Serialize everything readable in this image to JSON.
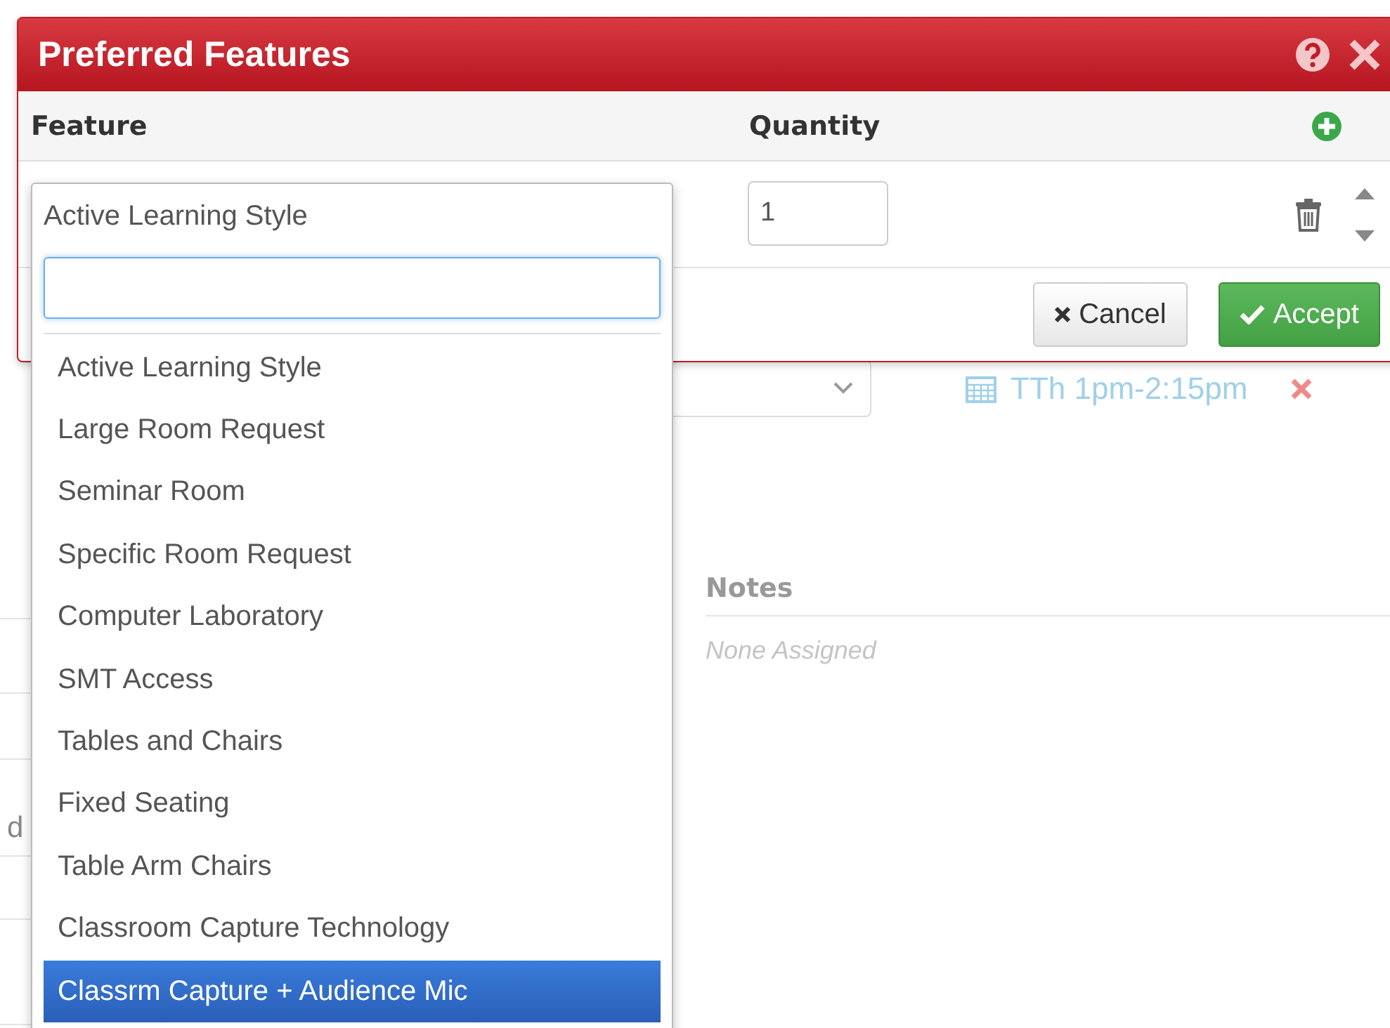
{
  "background": {
    "schedule": "TTh 1pm-2:15pm",
    "notes_heading": "Notes",
    "notes_value": "None Assigned",
    "side_text": "d"
  },
  "dialog": {
    "title": "Preferred Features",
    "columns": [
      "Feature",
      "Quantity"
    ],
    "rows": [
      {
        "feature": "Active Learning Style",
        "quantity": "1"
      }
    ],
    "buttons": [
      {
        "label": "Cancel",
        "kind": "cancel"
      },
      {
        "label": "Accept",
        "kind": "accept"
      }
    ]
  },
  "dropdown": {
    "options": [
      {
        "label": "Active Learning Style",
        "selected": false
      },
      {
        "label": "Large Room Request",
        "selected": false
      },
      {
        "label": "Seminar Room",
        "selected": false
      },
      {
        "label": "Specific Room Request",
        "selected": false
      },
      {
        "label": "Computer Laboratory",
        "selected": false
      },
      {
        "label": "SMT Access",
        "selected": false
      },
      {
        "label": "Tables and Chairs",
        "selected": false
      },
      {
        "label": "Fixed Seating",
        "selected": false
      },
      {
        "label": "Table Arm Chairs",
        "selected": false
      },
      {
        "label": "Classroom Capture Technology",
        "selected": false
      },
      {
        "label": "Classrm Capture + Audience Mic",
        "selected": true
      }
    ]
  }
}
